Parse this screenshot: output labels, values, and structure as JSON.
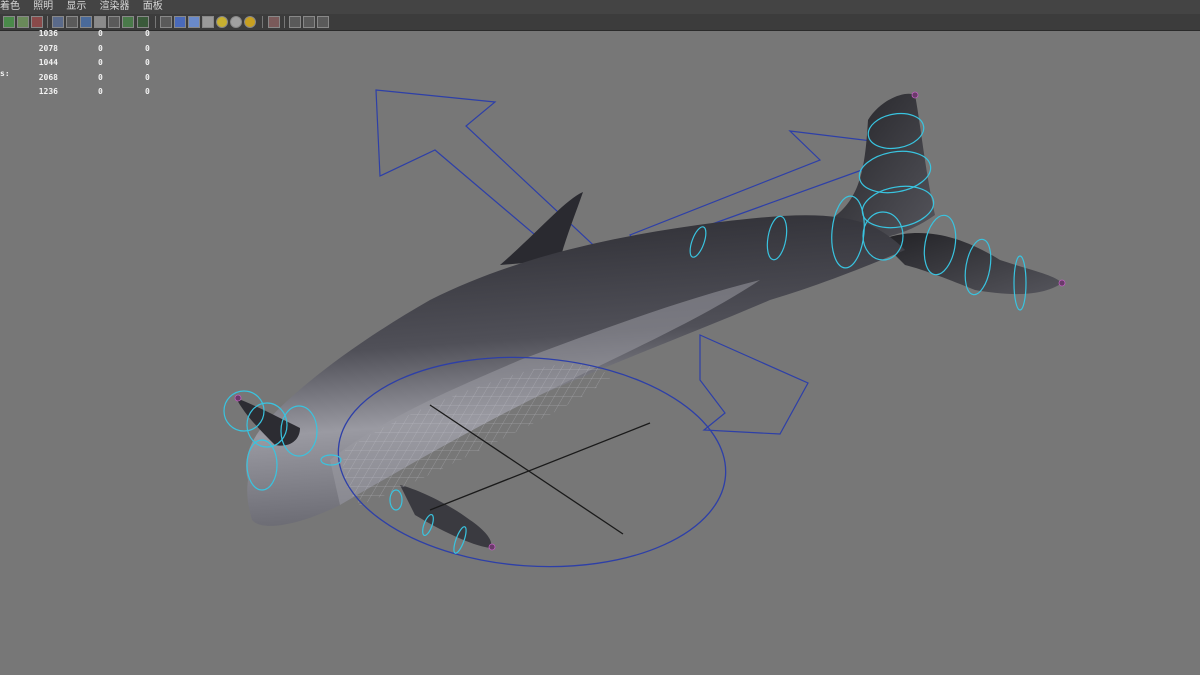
{
  "menu": {
    "items": [
      "着色",
      "照明",
      "显示",
      "渲染器",
      "面板"
    ]
  },
  "toolbar": {
    "buttons": [
      "panel-layout-icon",
      "camera-icon",
      "bookmark-icon",
      "grid-icon",
      "film-gate-icon",
      "resolution-gate-icon",
      "safe-area-icon",
      "field-chart-icon",
      "xray-icon",
      "texture-icon",
      "wireframe-icon",
      "smooth-shade-icon",
      "texture-shade-icon",
      "checker-icon",
      "default-light-icon",
      "all-lights-icon",
      "shadow-icon",
      "isolate-select-icon",
      "object-icon",
      "component-icon",
      "share-icon"
    ]
  },
  "hud": {
    "rows": [
      {
        "a": "1036",
        "b": "0",
        "c": "0"
      },
      {
        "a": "2078",
        "b": "0",
        "c": "0"
      },
      {
        "a": "1044",
        "b": "0",
        "c": "0"
      },
      {
        "a": "2068",
        "b": "0",
        "c": "0"
      },
      {
        "a": "1236",
        "b": "0",
        "c": "0"
      }
    ],
    "left_fragment": "s:"
  },
  "viewport": {
    "background": "#777777",
    "body_color": "#3a3a40",
    "belly_color": "#8a8a92",
    "control_curve_color": "#39c4e0",
    "manipulator_color": "#2d3fa8"
  }
}
